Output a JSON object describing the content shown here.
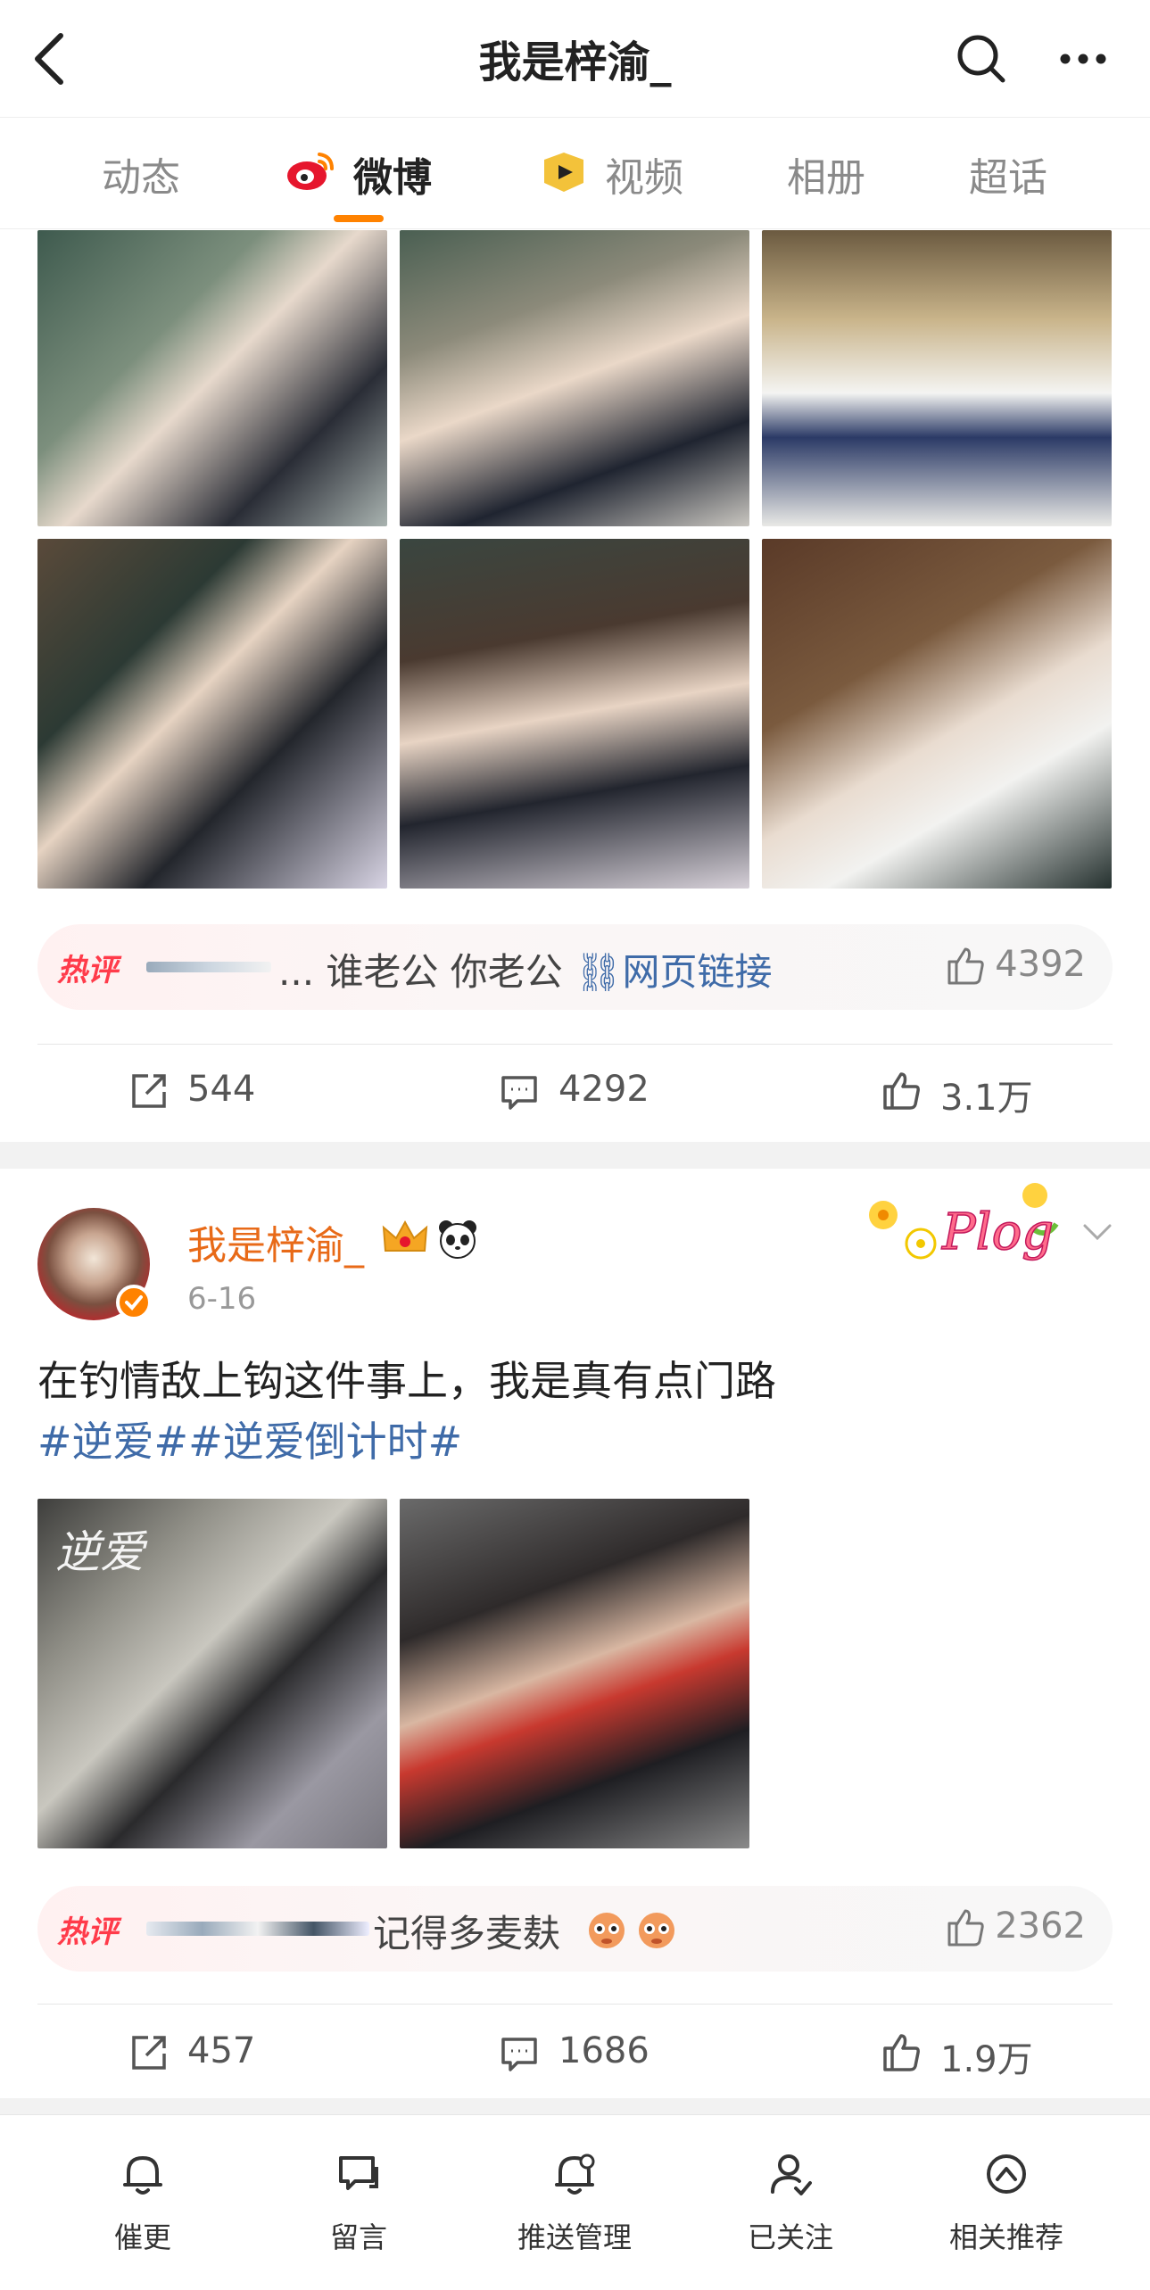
{
  "header": {
    "title": "我是梓渝_",
    "back_icon": "back-arrow-icon",
    "search_icon": "search-icon",
    "more_icon": "more-icon"
  },
  "tabs": [
    {
      "label": "动态"
    },
    {
      "label": "微博"
    },
    {
      "label": "视频"
    },
    {
      "label": "相册"
    },
    {
      "label": "超话"
    }
  ],
  "post1": {
    "hot_comment": {
      "tag": "热评",
      "text_prefix": "...",
      "text": "谁老公 你老公",
      "link": "网页链接",
      "likes": "4392"
    },
    "actions": {
      "reposts": "544",
      "comments": "4292",
      "likes": "3.1万"
    }
  },
  "post2": {
    "username": "我是梓渝_",
    "date": "6-16",
    "badge_text": "Plog",
    "text": "在钓情敌上钩这件事上，我是真有点门路",
    "hashtags": "#逆爱##逆爱倒计时#",
    "image_watermark": "逆爱",
    "hot_comment": {
      "tag": "热评",
      "text": "记得多麦麸",
      "likes": "2362"
    },
    "actions": {
      "reposts": "457",
      "comments": "1686",
      "likes": "1.9万"
    }
  },
  "bottom_nav": [
    {
      "label": "催更",
      "icon": "bell-icon"
    },
    {
      "label": "留言",
      "icon": "message-icon"
    },
    {
      "label": "推送管理",
      "icon": "bell-settings-icon"
    },
    {
      "label": "已关注",
      "icon": "user-check-icon"
    },
    {
      "label": "相关推荐",
      "icon": "recommend-icon"
    }
  ],
  "colors": {
    "accent": "#ff8200",
    "link": "#3f6ba8",
    "username": "#e86a18",
    "hot": "#ff3b4a"
  }
}
